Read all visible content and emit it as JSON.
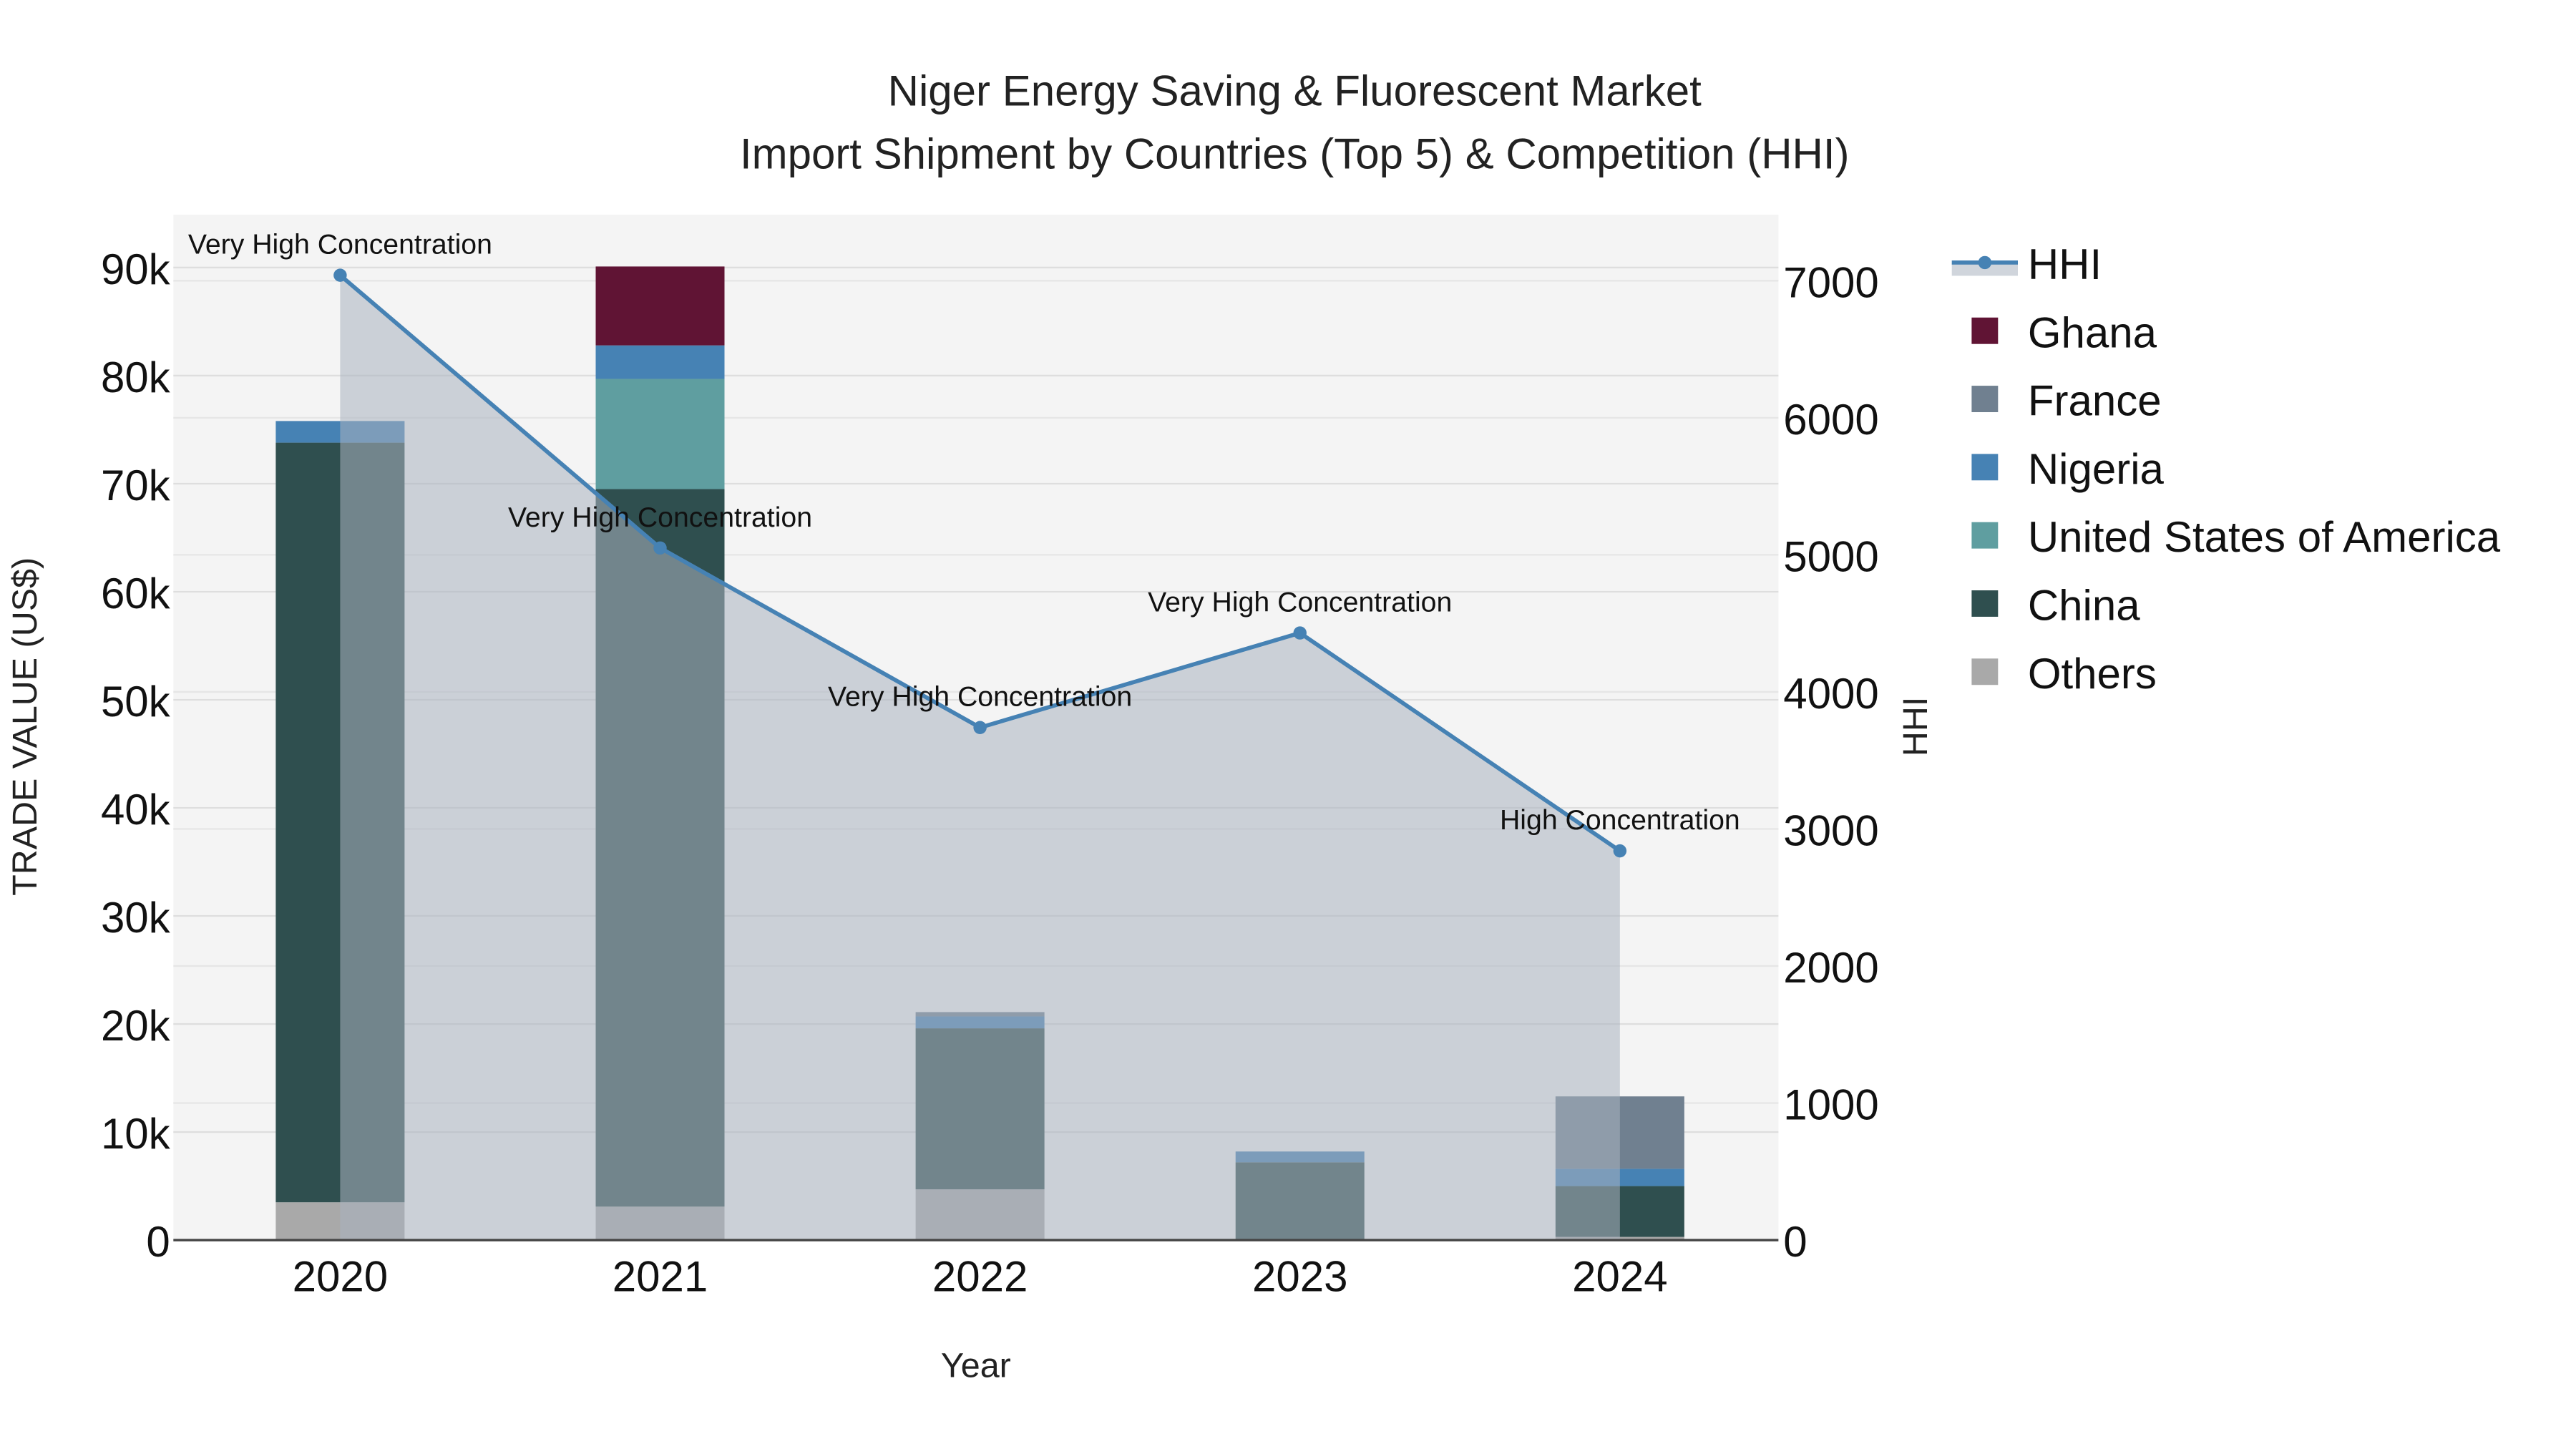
{
  "chart_data": {
    "type": "bar",
    "stacked": true,
    "title": "Niger Energy Saving & Fluorescent Market",
    "subtitle": "Import Shipment by Countries (Top 5) & Competition (HHI)",
    "xlabel": "Year",
    "ylabel": "TRADE VALUE (US$)",
    "y2label": "HHI",
    "categories": [
      "2020",
      "2021",
      "2022",
      "2023",
      "2024"
    ],
    "ylim": [
      0,
      95000
    ],
    "y_ticks": [
      0,
      10000,
      20000,
      30000,
      40000,
      50000,
      60000,
      70000,
      80000,
      90000
    ],
    "y_tick_labels": [
      "0",
      "10k",
      "20k",
      "30k",
      "40k",
      "50k",
      "60k",
      "70k",
      "80k",
      "90k"
    ],
    "y2lim": [
      0,
      7400
    ],
    "y2_ticks": [
      0,
      1000,
      2000,
      3000,
      4000,
      5000,
      6000,
      7000
    ],
    "y2_tick_labels": [
      "0",
      "1000",
      "2000",
      "3000",
      "4000",
      "5000",
      "6000",
      "7000"
    ],
    "series": [
      {
        "name": "Others",
        "color": "#A9A9A9",
        "values": [
          3500,
          3100,
          4700,
          100,
          300
        ]
      },
      {
        "name": "China",
        "color": "#2F4F4F",
        "values": [
          70300,
          66400,
          14900,
          7100,
          4700
        ]
      },
      {
        "name": "United States of America",
        "color": "#5F9EA0",
        "values": [
          0,
          10200,
          0,
          0,
          0
        ]
      },
      {
        "name": "Nigeria",
        "color": "#4682B4",
        "values": [
          2000,
          3100,
          1100,
          1000,
          1600
        ]
      },
      {
        "name": "France",
        "color": "#708090",
        "values": [
          0,
          0,
          400,
          0,
          6700
        ]
      },
      {
        "name": "Ghana",
        "color": "#601434",
        "values": [
          0,
          7300,
          0,
          0,
          0
        ]
      }
    ],
    "line_series": {
      "name": "HHI",
      "color": "#4682B4",
      "axis": "right",
      "values": [
        7040,
        5050,
        3740,
        4430,
        2840
      ],
      "annotations": [
        "Very High Concentration",
        "Very High Concentration",
        "Very High Concentration",
        "Very High Concentration",
        "High Concentration"
      ]
    },
    "legend": {
      "placement": "right",
      "entries": [
        "HHI",
        "Ghana",
        "France",
        "Nigeria",
        "United States of America",
        "China",
        "Others"
      ]
    },
    "grid": true
  }
}
